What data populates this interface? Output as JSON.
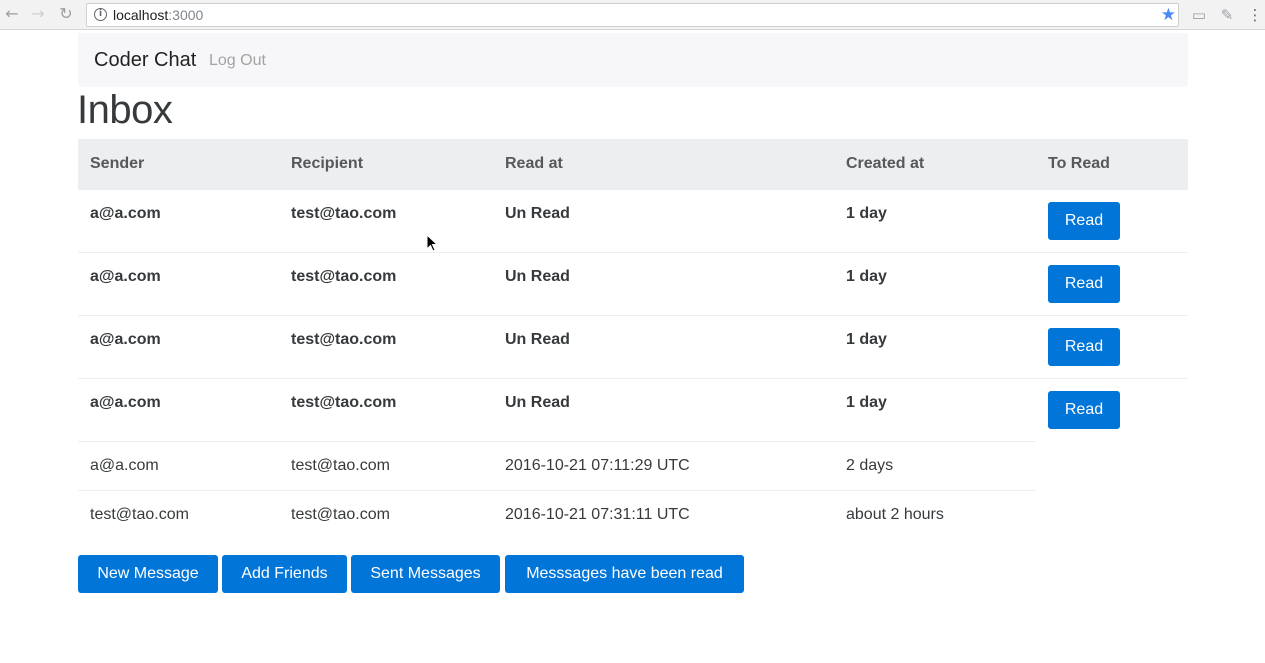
{
  "browser": {
    "url_host": "localhost",
    "url_port": ":3000"
  },
  "navbar": {
    "brand": "Coder Chat",
    "logout": "Log Out"
  },
  "page": {
    "title": "Inbox"
  },
  "table": {
    "headers": [
      "Sender",
      "Recipient",
      "Read at",
      "Created at",
      "To Read"
    ],
    "unread_rows": [
      {
        "sender": "a@a.com",
        "recipient": "test@tao.com",
        "read_at": "Un Read",
        "created_at": "1 day",
        "button": "Read"
      },
      {
        "sender": "a@a.com",
        "recipient": "test@tao.com",
        "read_at": "Un Read",
        "created_at": "1 day",
        "button": "Read"
      },
      {
        "sender": "a@a.com",
        "recipient": "test@tao.com",
        "read_at": "Un Read",
        "created_at": "1 day",
        "button": "Read"
      },
      {
        "sender": "a@a.com",
        "recipient": "test@tao.com",
        "read_at": "Un Read",
        "created_at": "1 day",
        "button": "Read"
      }
    ],
    "read_rows": [
      {
        "sender": "a@a.com",
        "recipient": "test@tao.com",
        "read_at": "2016-10-21 07:11:29 UTC",
        "created_at": "2 days"
      },
      {
        "sender": "test@tao.com",
        "recipient": "test@tao.com",
        "read_at": "2016-10-21 07:31:11 UTC",
        "created_at": "about 2 hours"
      }
    ]
  },
  "actions": {
    "new_message": "New Message",
    "add_friends": "Add Friends",
    "sent_messages": "Sent Messages",
    "messages_read": "Messsages have been read"
  },
  "colors": {
    "primary": "#0275d8",
    "table_header_bg": "#eceeef",
    "navbar_bg": "#f7f7f9"
  }
}
